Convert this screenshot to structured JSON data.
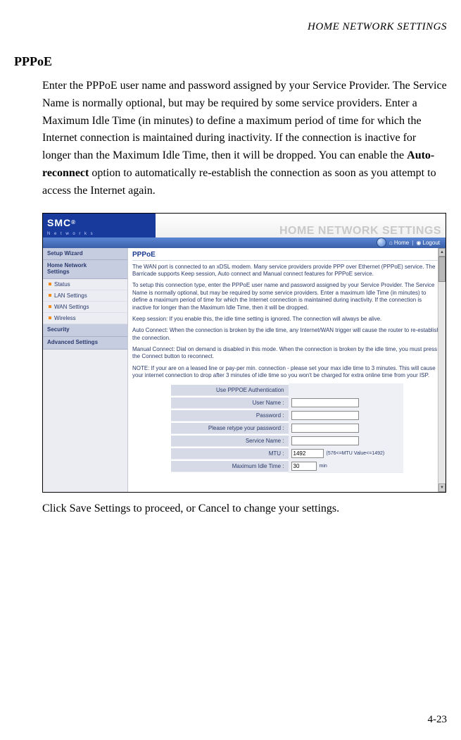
{
  "header": "HOME NETWORK SETTINGS",
  "section_title": "PPPoE",
  "body_paragraph_a": "Enter the PPPoE user name and password assigned by your Service Provider. The Service Name is normally optional, but may be required by some service providers. Enter a Maximum Idle Time (in minutes) to define a maximum period of time for which the Internet connection is maintained during inactivity. If the connection is inactive for longer than the Maximum Idle Time, then it will be dropped. You can enable the ",
  "body_bold": "Auto-reconnect",
  "body_paragraph_b": " option to automatically re-establish the connection as soon as you attempt to access the Internet again.",
  "footer_a": "Click ",
  "footer_b_bold": "Save Settings",
  "footer_c": " to proceed, or ",
  "footer_d_bold": "Cancel",
  "footer_e": " to change your settings.",
  "page_number": "4-23",
  "screenshot": {
    "logo_text": "SMC",
    "logo_reg": "®",
    "logo_sub": "N e t w o r k s",
    "banner_title": "HOME NETWORK SETTINGS",
    "toolbar": {
      "home": "Home",
      "logout": "Logout"
    },
    "sidebar": {
      "setup_wizard": "Setup Wizard",
      "home_net": "Home Network\nSettings",
      "items": [
        {
          "label": "Status"
        },
        {
          "label": "LAN Settings"
        },
        {
          "label": "WAN Settings"
        },
        {
          "label": "Wireless"
        }
      ],
      "security": "Security",
      "advanced": "Advanced Settings"
    },
    "content": {
      "title": "PPPoE",
      "p1": "The WAN port is connected to an xDSL modem. Many service providers provide PPP over Ethernet (PPPoE) service. The Barricade supports Keep session, Auto connect and Manual connect features for PPPoE service.",
      "p2": "To setup this connection type, enter the PPPoE user name and password assigned by your Service Provider. The Service Name is normally optional, but may be required by some service providers. Enter a maximum Idle Time (in minutes) to define a maximum period of time for which the Internet connection is maintained during inactivity. If the connection is inactive for longer than the Maximum Idle Time, then it will be dropped.",
      "p3": "Keep session: If you enable this, the idle time setting is ignored. The connection will always be alive.",
      "p4": "Auto Connect: When the connection is broken by the idle time, any Internet/WAN trigger will cause the router to re-establish the connection.",
      "p5": "Manual Connect: Dial on demand is disabled in this mode. When the connection is broken by the idle time, you must press the Connect button to reconnect.",
      "p6": "NOTE: If your are on a leased line or pay-per min. connection - please set your max idle time to 3 minutes. This will cause your internet connection to drop after 3 minutes of idle time so you won't be charged for extra online time from your ISP.",
      "form": {
        "auth_label": "Use PPPOE Authentication",
        "user_label": "User Name :",
        "user_value": "",
        "pass_label": "Password :",
        "pass_value": "",
        "pass2_label": "Please retype your password :",
        "pass2_value": "",
        "service_label": "Service Name :",
        "service_value": "",
        "mtu_label": "MTU :",
        "mtu_value": "1492",
        "mtu_hint": "(576<=MTU Value<=1492)",
        "idle_label": "Maximum Idle Time :",
        "idle_value": "30",
        "idle_hint": "min"
      }
    }
  }
}
